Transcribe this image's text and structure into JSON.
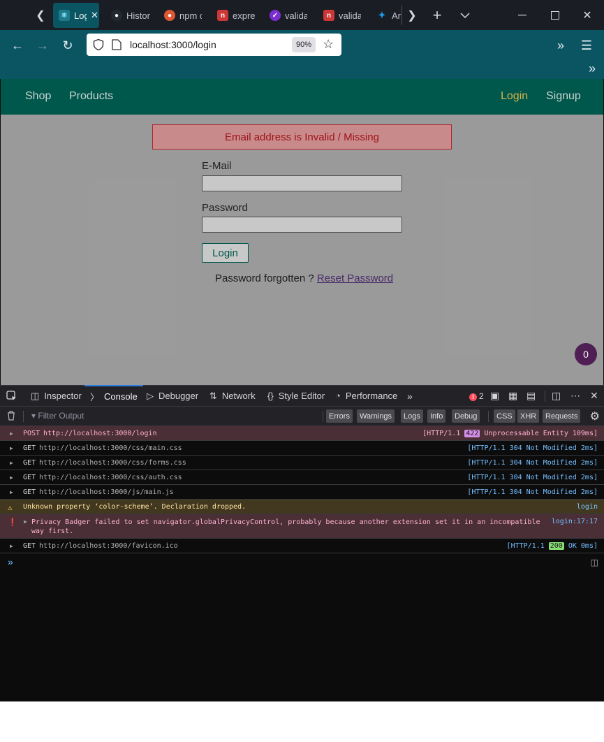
{
  "browser": {
    "tabs": [
      {
        "title": "Log",
        "favicon": "react-logo-icon",
        "active": true
      },
      {
        "title": "Histor",
        "favicon": "github-icon"
      },
      {
        "title": "npm c",
        "favicon": "duckduckgo-icon"
      },
      {
        "title": "expres",
        "favicon": "npm-icon"
      },
      {
        "title": "valida",
        "favicon": "check-icon"
      },
      {
        "title": "valida",
        "favicon": "npm-icon"
      },
      {
        "title": "Ar",
        "favicon": "twitter-icon"
      }
    ],
    "url": "localhost:3000/login",
    "zoom": "90%"
  },
  "site": {
    "nav_left": [
      "Shop",
      "Products"
    ],
    "nav_login": "Login",
    "nav_signup": "Signup",
    "error_message": "Email address is Invalid / Missing",
    "email_label": "E-Mail",
    "password_label": "Password",
    "login_button": "Login",
    "forgot_text": "Password forgotten ?",
    "reset_link": "Reset Password",
    "cart_count": "0"
  },
  "devtools": {
    "tabs": {
      "inspector": "Inspector",
      "console": "Console",
      "debugger": "Debugger",
      "network": "Network",
      "style_editor": "Style Editor",
      "performance": "Performance"
    },
    "error_count": "2",
    "filter_placeholder": "Filter Output",
    "filters": [
      "Errors",
      "Warnings",
      "Logs",
      "Info",
      "Debug"
    ],
    "net_filters": [
      "CSS",
      "XHR",
      "Requests"
    ],
    "logs": [
      {
        "method": "POST",
        "url": "http://localhost:3000/login",
        "pre": "[HTTP/1.1 ",
        "code": "422",
        "post": " Unprocessable Entity 109ms]"
      },
      {
        "method": "GET",
        "url": "http://localhost:3000/css/main.css",
        "pre": "[HTTP/1.1 304 Not Modified 2ms]"
      },
      {
        "method": "GET",
        "url": "http://localhost:3000/css/forms.css",
        "pre": "[HTTP/1.1 304 Not Modified 2ms]"
      },
      {
        "method": "GET",
        "url": "http://localhost:3000/css/auth.css",
        "pre": "[HTTP/1.1 304 Not Modified 2ms]"
      },
      {
        "method": "GET",
        "url": "http://localhost:3000/js/main.js",
        "pre": "[HTTP/1.1 304 Not Modified 2ms]"
      }
    ],
    "warning": {
      "text": "Unknown property ‘color-scheme’.  Declaration dropped.",
      "source": "login"
    },
    "error": {
      "text": "Privacy Badger failed to set navigator.globalPrivacyControl, probably because another extension set it in an incompatible way first.",
      "source": "login:17:17"
    },
    "favicon_log": {
      "method": "GET",
      "url": "http://localhost:3000/favicon.ico",
      "pre": "[HTTP/1.1 ",
      "code": "200",
      "post": " OK 0ms]"
    }
  },
  "colors": {
    "chrome_teal": "#0b5563",
    "site_header": "#00574b",
    "error_bg": "#c88a8a",
    "error_text": "#a0141c",
    "badge_purple": "#4e1e55",
    "code_422_bg": "#d48ee6",
    "code_200_bg": "#86de74"
  }
}
